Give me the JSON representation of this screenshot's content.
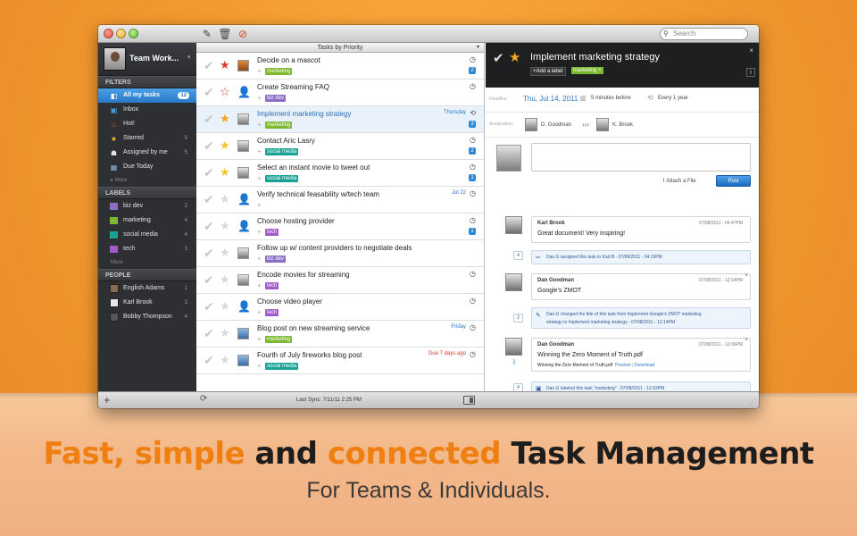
{
  "colors": {
    "orange": "#f07f12",
    "marketing": "#7cb832",
    "biz_dev": "#8b6fc7",
    "social_media": "#1aa394",
    "tech": "#a05ac9",
    "accent_blue": "#2a78c8"
  },
  "toolbar": {
    "compose_icon": "compose-icon",
    "trash_icon": "trash-icon",
    "alert_icon": "alert-icon",
    "search_placeholder": "Search"
  },
  "sidebar": {
    "team_name": "Team Work...",
    "filters_header": "FILTERS",
    "filters": [
      {
        "label": "All my tasks",
        "count": "12",
        "icon": "tasks-icon"
      },
      {
        "label": "Inbox",
        "count": "",
        "icon": "inbox-icon"
      },
      {
        "label": "Hot!",
        "count": "",
        "icon": "fire-icon"
      },
      {
        "label": "Starred",
        "count": "5",
        "icon": "star-icon"
      },
      {
        "label": "Assigned by me",
        "count": "5",
        "icon": "assigned-icon"
      },
      {
        "label": "Due Today",
        "count": "",
        "icon": "calendar-icon"
      }
    ],
    "more_label": "More",
    "labels_header": "LABELS",
    "labels": [
      {
        "label": "biz dev",
        "count": "2",
        "color": "#8b6fc7"
      },
      {
        "label": "marketing",
        "count": "4",
        "color": "#7cb832"
      },
      {
        "label": "social media",
        "count": "4",
        "color": "#1aa394"
      },
      {
        "label": "tech",
        "count": "3",
        "color": "#a05ac9"
      }
    ],
    "labels_more": "More",
    "people_header": "PEOPLE",
    "people": [
      {
        "label": "English Adams",
        "count": "1"
      },
      {
        "label": "Karl Brook",
        "count": "3"
      },
      {
        "label": "Bobby Thompson",
        "count": "4"
      }
    ]
  },
  "list": {
    "header": "Tasks by Priority",
    "tasks": [
      {
        "title": "Decide on a mascot",
        "tag": "marketing",
        "tag_color": "#7cb832",
        "due": "",
        "num": "2"
      },
      {
        "title": "Create Streaming FAQ",
        "tag": "biz dev",
        "tag_color": "#8b6fc7",
        "due": "",
        "num": ""
      },
      {
        "title": "Implement marketing strategy",
        "tag": "marketing",
        "tag_color": "#7cb832",
        "due": "Thursday",
        "num": "3"
      },
      {
        "title": "Contact Aric Lasry",
        "tag": "social media",
        "tag_color": "#1aa394",
        "due": "",
        "num": "2"
      },
      {
        "title": "Select an instant movie to tweet out",
        "tag": "social media",
        "tag_color": "#1aa394",
        "due": "",
        "num": "1"
      },
      {
        "title": "Verify technical feasability w/tech team",
        "tag": "",
        "tag_color": "",
        "due": "Jul 22",
        "num": ""
      },
      {
        "title": "Choose hosting provider",
        "tag": "tech",
        "tag_color": "#a05ac9",
        "due": "",
        "num": "1"
      },
      {
        "title": "Follow up w/ content providers to negotiate deals",
        "tag": "biz dev",
        "tag_color": "#8b6fc7",
        "due": "",
        "num": ""
      },
      {
        "title": "Encode movies for streaming",
        "tag": "tech",
        "tag_color": "#a05ac9",
        "due": "",
        "num": ""
      },
      {
        "title": "Choose video player",
        "tag": "tech",
        "tag_color": "#a05ac9",
        "due": "",
        "num": ""
      },
      {
        "title": "Blog post on new streaming service",
        "tag": "marketing",
        "tag_color": "#7cb832",
        "due": "Friday",
        "num": ""
      },
      {
        "title": "Fourth of July fireworks blog post",
        "tag": "social media",
        "tag_color": "#1aa394",
        "due": "Due 7 days ago",
        "num": ""
      }
    ]
  },
  "detail": {
    "title": "Implement marketing strategy",
    "add_label": "+Add a label",
    "tag": "marketing ×",
    "close": "×",
    "info": "i",
    "deadline_label": "Deadline:",
    "deadline_date": "Thu, Jul 14, 2011",
    "reminder": "5 minutes before",
    "repeat": "Every 1 year",
    "assignation_label": "Assignation:",
    "assigner": "D. Goodman",
    "arrows": "›››",
    "assignee": "K. Brook",
    "attach": "Attach a File",
    "post": "Post",
    "comments": [
      {
        "name": "Karl Brook",
        "time": "07/08/2011 - 04:47PM",
        "body": "Great document! Very inspiring!"
      },
      {
        "name": "Dan Goodman",
        "time": "07/08/2011 - 12:14PM",
        "body": "Google's ZMOT"
      },
      {
        "name": "Dan Goodman",
        "time": "07/08/2011 - 12:06PM",
        "body": "Winning the Zero Moment of Truth.pdf",
        "file": "Winning the Zero Moment of Truth.pdf",
        "preview": "Preview",
        "sep": "|",
        "download": "Download"
      }
    ],
    "activities": [
      {
        "badge": "4",
        "text": "Dan.G assigned this task to Karl.B - 07/08/2011 - 04:19PM"
      },
      {
        "badge": "2",
        "text_line1": "Dan.G changed the title of this task from Implement Google's ZMOT marketing",
        "text_line2": "strategy to Implement marketing strategy - 07/08/2011 - 12:14PM"
      },
      {
        "badge": "4",
        "text": "Dan.G labeled this task \"marketing\" - 07/08/2011 - 12:03PM"
      }
    ]
  },
  "bottombar": {
    "add": "+",
    "sync": "Last Sync: 7/11/11 2:25 PM"
  },
  "tagline": {
    "w1": "Fast,",
    "w2": "simple",
    "w3": "and",
    "w4": "connected",
    "w5": "Task Management",
    "sub": "For Teams & Individuals."
  }
}
